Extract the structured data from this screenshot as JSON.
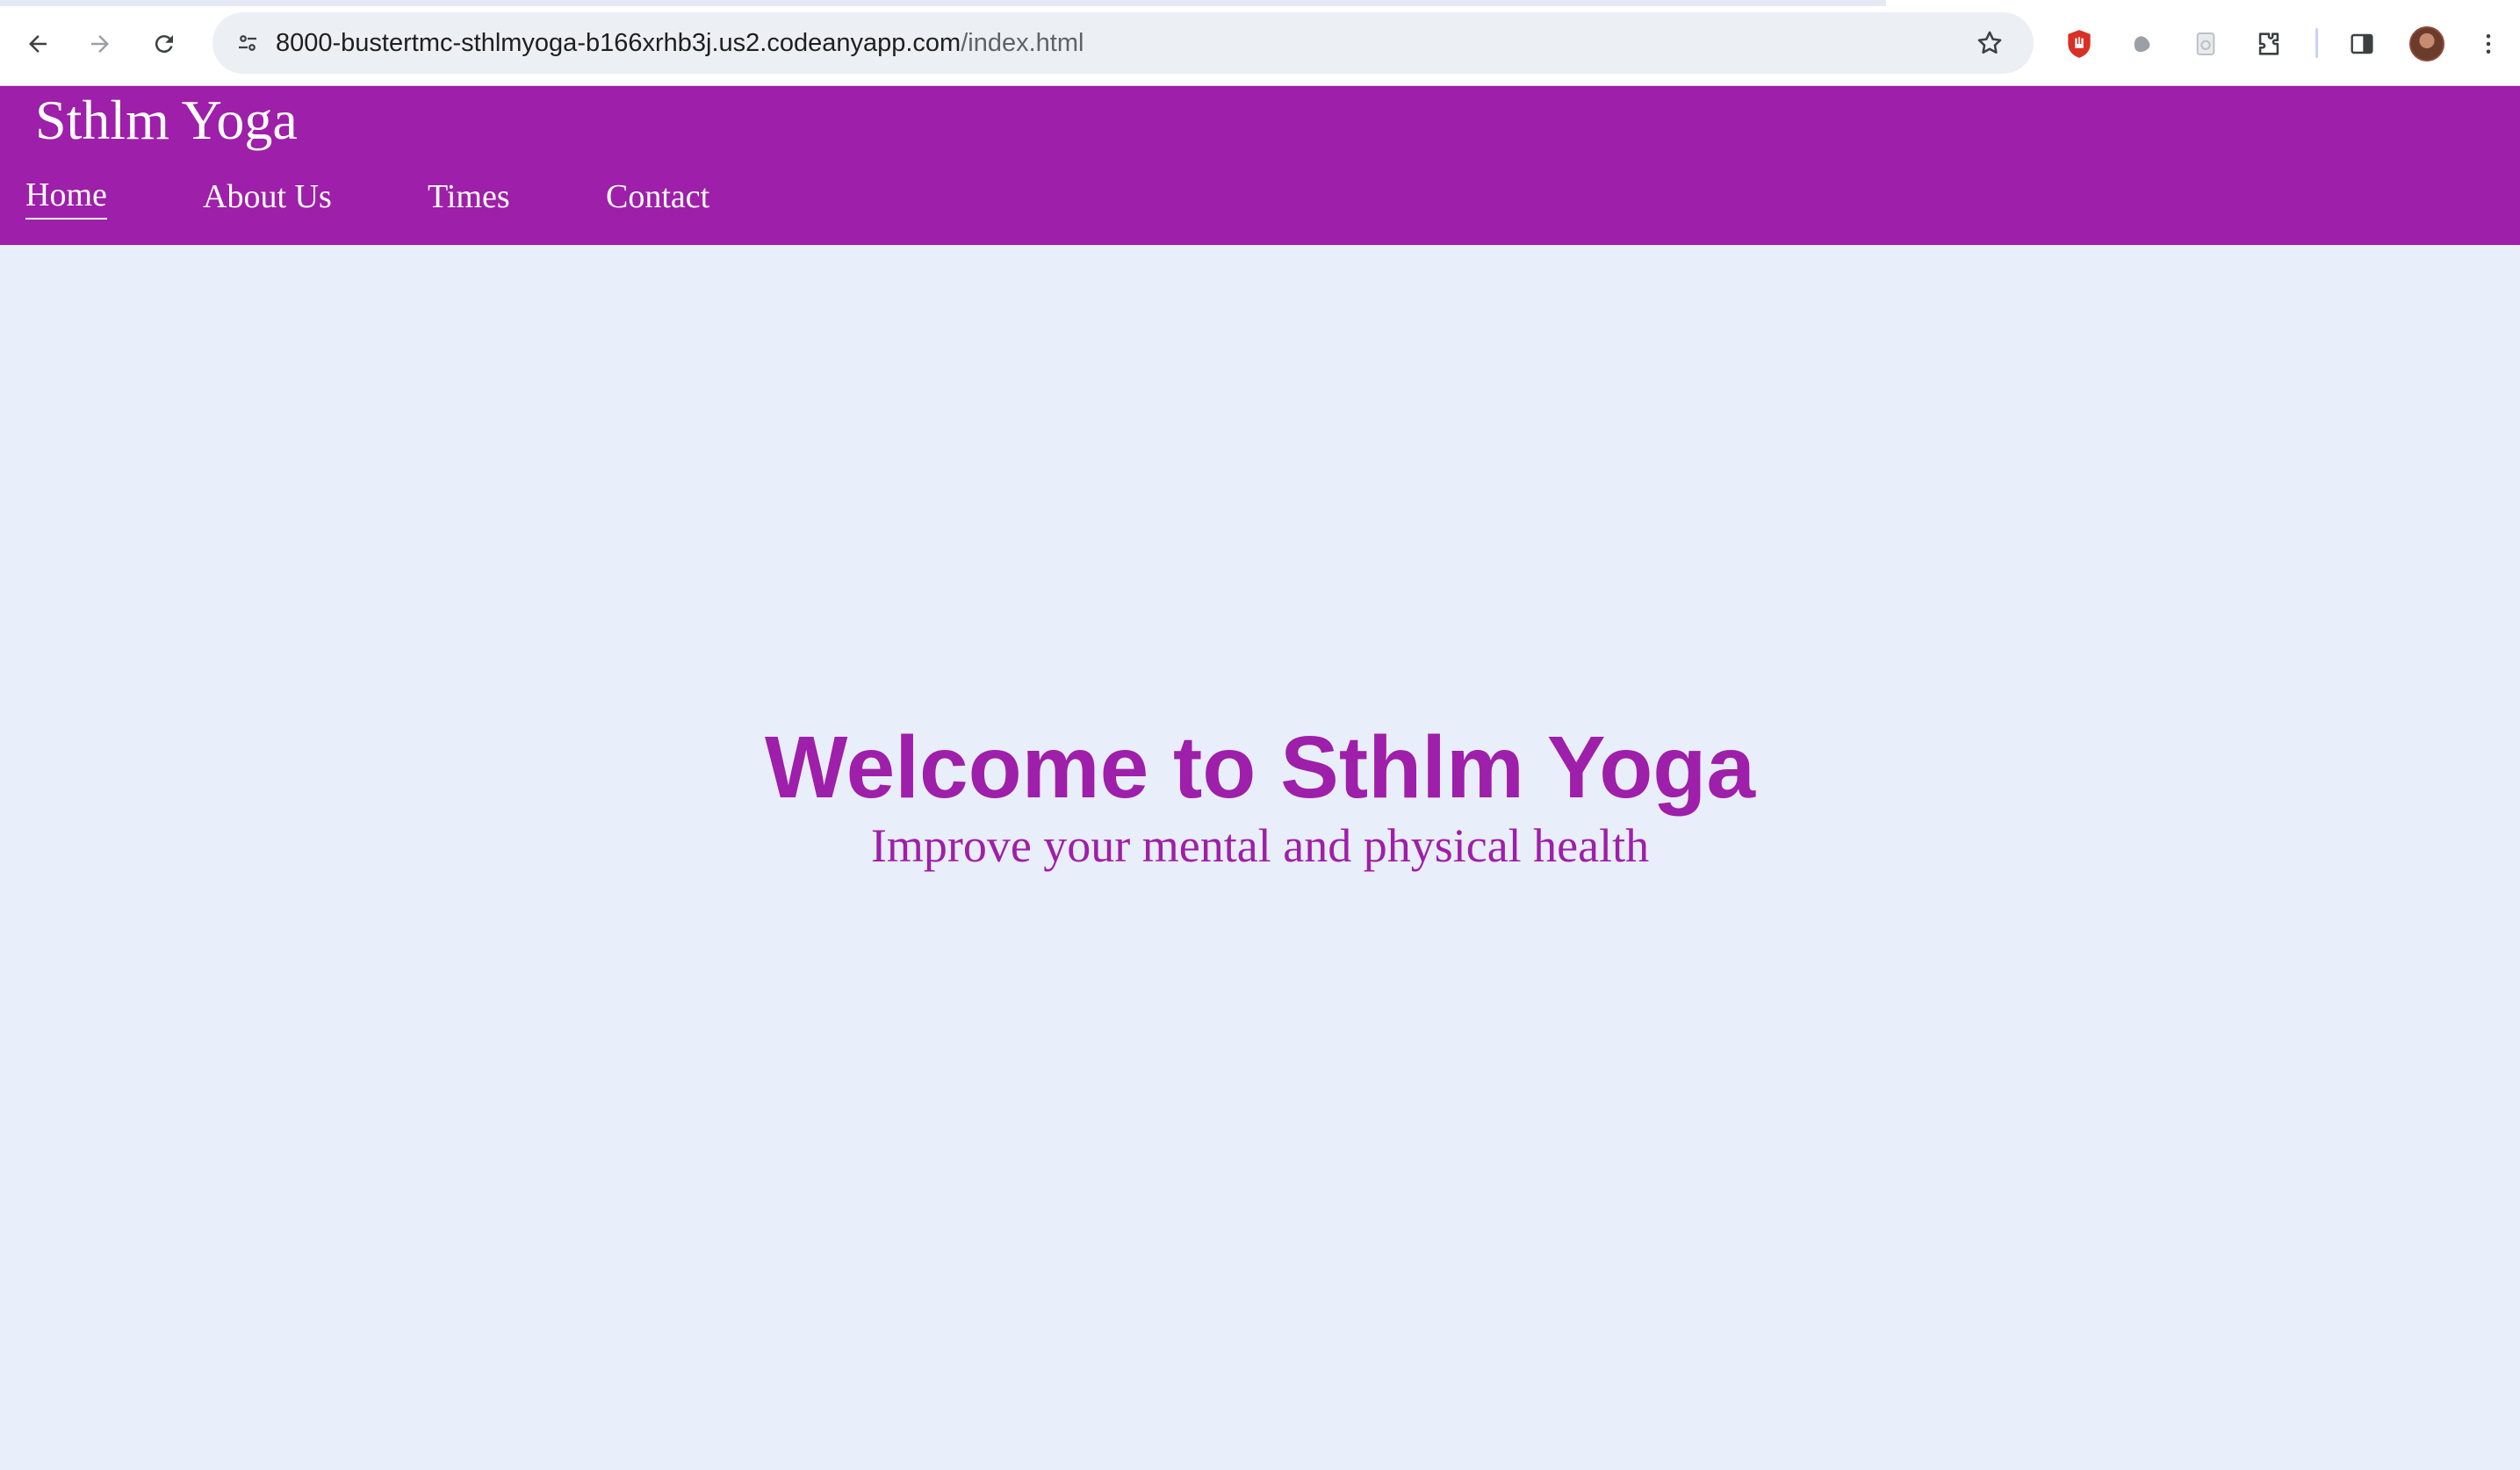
{
  "browser": {
    "url_host": "8000-bustertmc-sthlmyoga-b166xrhb3j.us2.codeanyapp.com",
    "url_path": "/index.html",
    "icons": [
      "back-arrow-icon",
      "forward-arrow-icon",
      "reload-icon",
      "site-info-icon",
      "bookmark-star-icon",
      "ublock-shield-icon",
      "ghostery-icon",
      "save-page-icon",
      "extensions-puzzle-icon",
      "side-panel-icon",
      "profile-avatar"
    ]
  },
  "site": {
    "title": "Sthlm Yoga",
    "nav": {
      "home": "Home",
      "about": "About Us",
      "times": "Times",
      "contact": "Contact"
    },
    "active_nav": "Home"
  },
  "hero": {
    "heading": "Welcome to Sthlm Yoga",
    "subheading": "Improve your mental and physical health"
  },
  "colors": {
    "brand_purple": "#9e1fa9",
    "page_background": "#e8eefa",
    "header_text": "#ffffff"
  }
}
